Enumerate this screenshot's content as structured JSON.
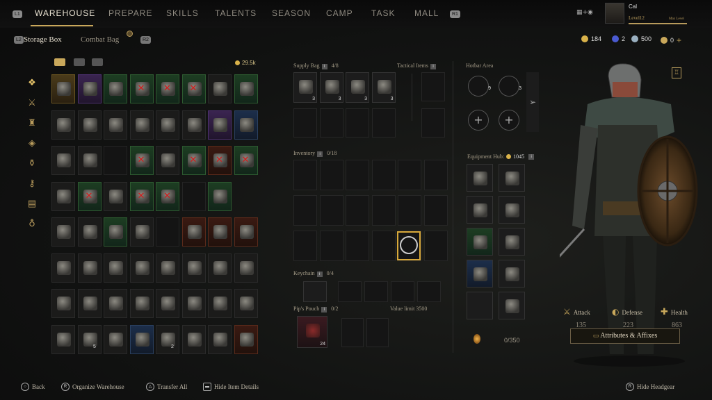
{
  "nav": {
    "left_hint": "L1",
    "right_hint": "R1",
    "tabs": [
      "WAREHOUSE",
      "PREPARE",
      "SKILLS",
      "TALENTS",
      "SEASON",
      "CAMP",
      "TASK",
      "MALL"
    ]
  },
  "profile": {
    "name": "Cal",
    "level": "Level12",
    "max": "Max Level"
  },
  "subtabs": {
    "storage": "Storage Box",
    "combat": "Combat Bag",
    "storage_hint": "L2",
    "combat_hint": "R2"
  },
  "currency": {
    "gold": "184",
    "potion": "2",
    "silver": "500",
    "coin": "0",
    "add": "+"
  },
  "storage": {
    "gold": "29.5k"
  },
  "supply_bag": {
    "title": "Supply Bag",
    "count": "4/8",
    "items": [
      "3",
      "3",
      "3",
      "3"
    ]
  },
  "tactical": {
    "title": "Tactical Items"
  },
  "hotbar": {
    "title": "Hotbar Area",
    "items": [
      "9",
      "3"
    ],
    "add": "+"
  },
  "inventory": {
    "title": "Inventory",
    "count": "0/18"
  },
  "keychain": {
    "title": "Keychain",
    "count": "0/4"
  },
  "pips_pouch": {
    "title": "Pip's Pouch",
    "count": "0/2",
    "value_limit": "Value limit",
    "value_amount": "3500",
    "item_count": "24"
  },
  "equipment": {
    "title": "Equipment Hub:",
    "value": "1045"
  },
  "weight": "0/350",
  "stats": {
    "attack": {
      "label": "Attack",
      "value": "135"
    },
    "defense": {
      "label": "Defense",
      "value": "223"
    },
    "health": {
      "label": "Health",
      "value": "863"
    }
  },
  "attributes_button": "Attributes & Affixes",
  "footer": {
    "back": "Back",
    "organize": "Organize Warehouse",
    "transfer": "Transfer All",
    "hide_details": "Hide Item Details",
    "hide_headgear": "Hide Headgear"
  },
  "grid_counts": {
    "c5": "5",
    "c2": "2"
  },
  "colors": {
    "accent": "#c9a85b",
    "rarity_green": "#2d5a30",
    "rarity_purple": "#4d3070",
    "rarity_gold": "#6a5420",
    "rarity_blue": "#2a4060"
  }
}
